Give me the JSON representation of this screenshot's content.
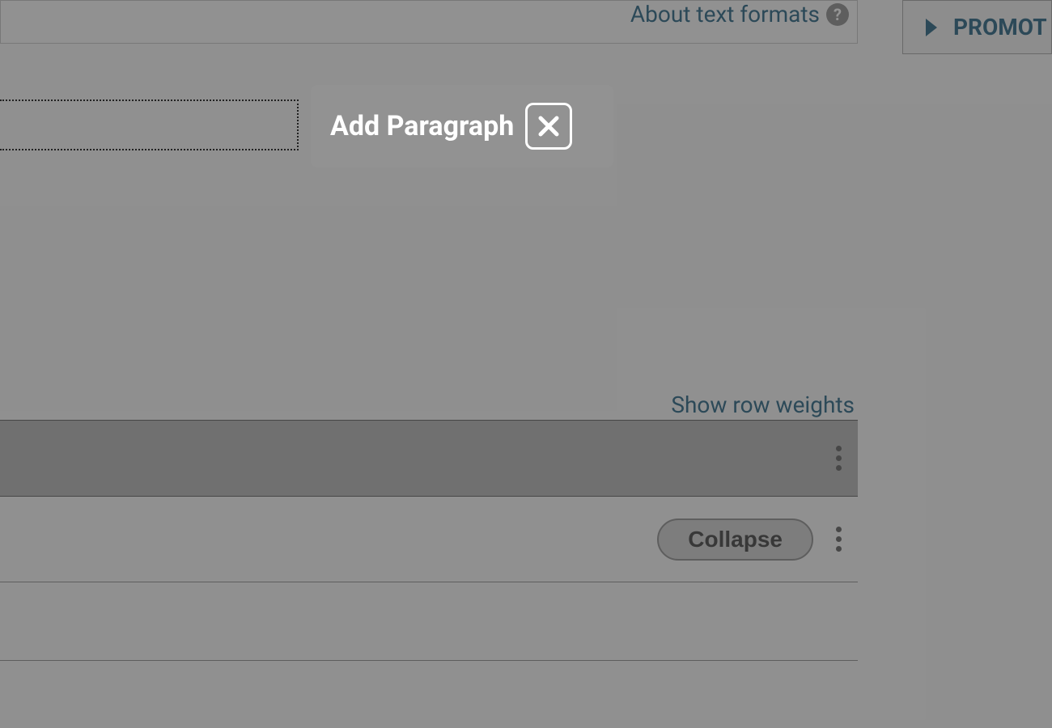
{
  "header": {
    "about_text_formats": "About text formats"
  },
  "dialog": {
    "title": "Add Paragraph"
  },
  "actions": {
    "show_row_weights": "Show row weights",
    "collapse": "Collapse"
  },
  "sidebar": {
    "promotion_label": "PROMOT"
  }
}
